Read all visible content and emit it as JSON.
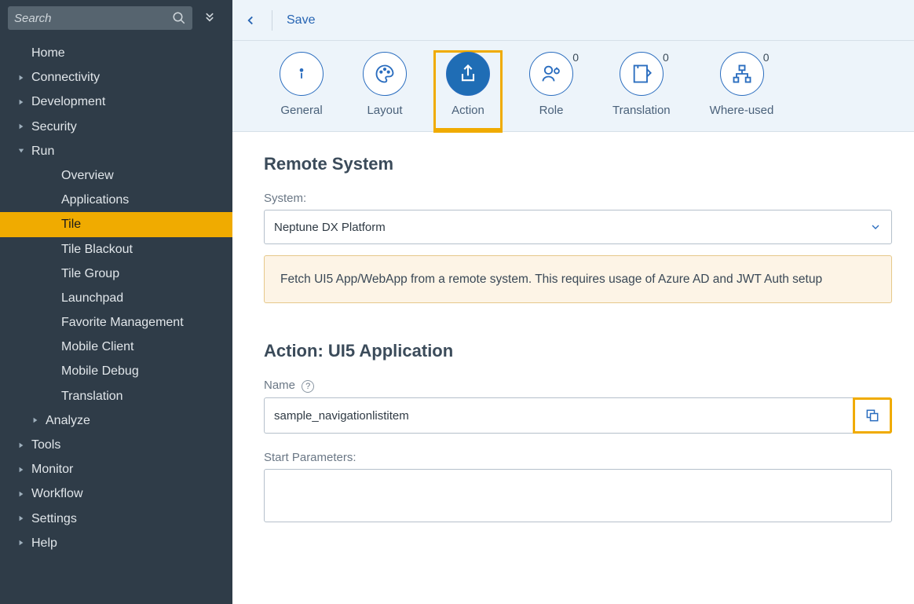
{
  "sidebar": {
    "search_placeholder": "Search",
    "items": [
      {
        "label": "Home",
        "level": 0,
        "caret": "none"
      },
      {
        "label": "Connectivity",
        "level": 0,
        "caret": "closed"
      },
      {
        "label": "Development",
        "level": 0,
        "caret": "closed"
      },
      {
        "label": "Security",
        "level": 0,
        "caret": "closed"
      },
      {
        "label": "Run",
        "level": 0,
        "caret": "open"
      },
      {
        "label": "Overview",
        "level": 2,
        "caret": "none"
      },
      {
        "label": "Applications",
        "level": 2,
        "caret": "none"
      },
      {
        "label": "Tile",
        "level": 2,
        "caret": "none",
        "selected": true
      },
      {
        "label": "Tile Blackout",
        "level": 2,
        "caret": "none"
      },
      {
        "label": "Tile Group",
        "level": 2,
        "caret": "none"
      },
      {
        "label": "Launchpad",
        "level": 2,
        "caret": "none"
      },
      {
        "label": "Favorite Management",
        "level": 2,
        "caret": "none"
      },
      {
        "label": "Mobile Client",
        "level": 2,
        "caret": "none"
      },
      {
        "label": "Mobile Debug",
        "level": 2,
        "caret": "none"
      },
      {
        "label": "Translation",
        "level": 2,
        "caret": "none"
      },
      {
        "label": "Analyze",
        "level": 1,
        "caret": "closed"
      },
      {
        "label": "Tools",
        "level": 0,
        "caret": "closed"
      },
      {
        "label": "Monitor",
        "level": 0,
        "caret": "closed"
      },
      {
        "label": "Workflow",
        "level": 0,
        "caret": "closed"
      },
      {
        "label": "Settings",
        "level": 0,
        "caret": "closed"
      },
      {
        "label": "Help",
        "level": 0,
        "caret": "closed"
      }
    ]
  },
  "topbar": {
    "save_label": "Save"
  },
  "tabs": [
    {
      "label": "General",
      "icon": "info"
    },
    {
      "label": "Layout",
      "icon": "palette"
    },
    {
      "label": "Action",
      "icon": "share",
      "active": true
    },
    {
      "label": "Role",
      "icon": "role",
      "badge": "0"
    },
    {
      "label": "Translation",
      "icon": "translate",
      "badge": "0"
    },
    {
      "label": "Where-used",
      "icon": "hierarchy",
      "badge": "0"
    }
  ],
  "remote_system": {
    "heading": "Remote System",
    "system_label": "System:",
    "system_value": "Neptune DX Platform",
    "info": "Fetch UI5 App/WebApp from a remote system. This requires usage of Azure AD and JWT Auth setup"
  },
  "action_section": {
    "heading": "Action: UI5 Application",
    "name_label": "Name",
    "name_value": "sample_navigationlistitem",
    "start_params_label": "Start Parameters:",
    "start_params_value": ""
  }
}
